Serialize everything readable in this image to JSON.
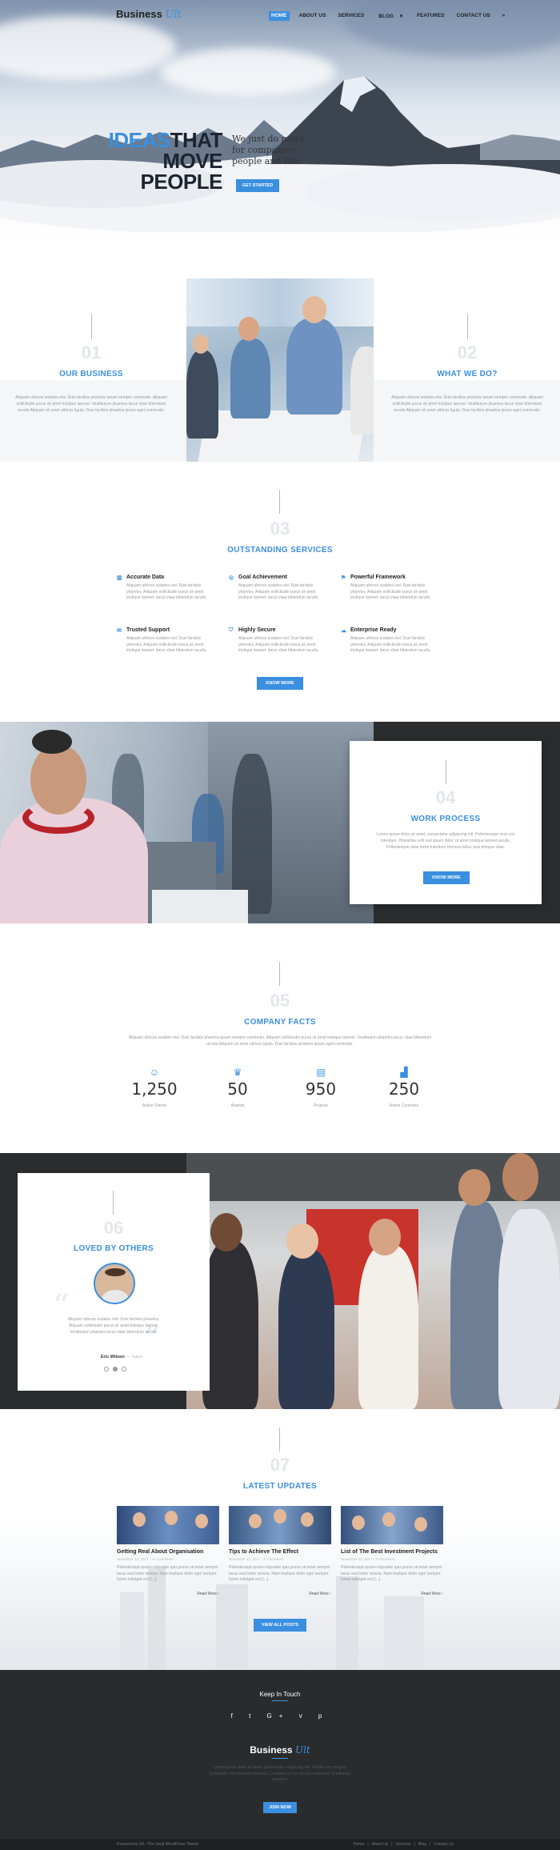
{
  "header": {
    "logo_text": "Business",
    "logo_accent": "Ult",
    "nav": [
      "HOME",
      "ABOUT US",
      "SERVICES",
      "BLOG",
      "FEATURES",
      "CONTACT US"
    ],
    "search_icon": "search-icon"
  },
  "hero": {
    "title_accent": "IDEAS",
    "title_1": "THAT",
    "title_2": "MOVE",
    "title_3": "PEOPLE",
    "subtitle": "We just do more for companies, people and life.",
    "button": "GET STARTED"
  },
  "about": {
    "left": {
      "number": "01",
      "title": "OUR BUSINESS",
      "text": "Aliquam ultrices sodales nisl. Duis facilisis pharetra ipsum semper commodo. Aliquam sollicitudin purus sit amet tristique laoreet. Vestibulum pharetra lacus vitae bibendum iaculis.Aliquam sit amet ultrices ligula. Duis facilisis pharetra ipsum eget commodo."
    },
    "right": {
      "number": "02",
      "title": "WHAT WE DO?",
      "text": "Aliquam ultrices sodales nisl. Duis facilisis pharetra ipsum semper commodo. Aliquam sollicitudin purus sit amet tristique laoreet. Vestibulum pharetra lacus vitae bibendum iaculis.Aliquam sit amet ultrices ligula. Duis facilisis pharetra ipsum eget commodo."
    }
  },
  "services": {
    "number": "03",
    "title": "OUTSTANDING SERVICES",
    "items": [
      {
        "title": "Accurate Data",
        "icon": "chart-icon",
        "text": "Aliquam ultrices sodales nisl. Duis facilisis pharetra. Aliquam sollicitudin purus sit amet tristique laoreet. lacus vitae bibendum iaculis."
      },
      {
        "title": "Goal Achievement",
        "icon": "target-icon",
        "text": "Aliquam ultrices sodales nisl. Duis facilisis pharetra. Aliquam sollicitudin purus sit amet tristique laoreet. lacus vitae bibendum iaculis."
      },
      {
        "title": "Powerful Framework",
        "icon": "flag-icon",
        "text": "Aliquam ultrices sodales nisl. Duis facilisis pharetra. Aliquam sollicitudin purus sit amet tristique laoreet. lacus vitae bibendum iaculis."
      },
      {
        "title": "Trusted Support",
        "icon": "chat-icon",
        "text": "Aliquam ultrices sodales nisl. Duis facilisis pharetra. Aliquam sollicitudin purus sit amet tristique laoreet. lacus vitae bibendum iaculis."
      },
      {
        "title": "Highly Secure",
        "icon": "shield-icon",
        "text": "Aliquam ultrices sodales nisl. Duis facilisis pharetra. Aliquam sollicitudin purus sit amet tristique laoreet. lacus vitae bibendum iaculis."
      },
      {
        "title": "Enterprise Ready",
        "icon": "cloud-icon",
        "text": "Aliquam ultrices sodales nisl. Duis facilisis pharetra. Aliquam sollicitudin purus sit amet tristique laoreet. lacus vitae bibendum iaculis."
      }
    ],
    "button": "KNOW MORE"
  },
  "work": {
    "number": "04",
    "title": "WORK PROCESS",
    "text": "Lorem ipsum dolor sit amet, consectetur adipiscing elit. Pellentesque risus est interdum. Phasellus velit sed ipsum dolor sit amet tristique laoreet iaculis. Pellentesque vitae tortor interdum rhoncus tellus quis tempus vitae.",
    "button": "KNOW MORE"
  },
  "facts": {
    "number": "05",
    "title": "COMPANY FACTS",
    "text": "Aliquam ultrices sodales nisl. Duis facilisis pharetra ipsum semper commodo. Aliquam sollicitudin purus sit amet tristique laoreet. Vestibulum pharetra lacus vitae bibendum iaculis.Aliquam sit amet ultrices ligula. Duis facilisis pharetra ipsum eget commodo.",
    "items": [
      {
        "value": "1,250",
        "label": "Active Clients",
        "icon": "user-icon"
      },
      {
        "value": "50",
        "label": "Awards",
        "icon": "trophy-icon"
      },
      {
        "value": "950",
        "label": "Projects",
        "icon": "briefcase-icon"
      },
      {
        "value": "250",
        "label": "Active Contracts",
        "icon": "chart-icon"
      }
    ]
  },
  "testimonial": {
    "number": "06",
    "title": "LOVED BY OTHERS",
    "text": "Aliquam ultrices sodales nisl. Duis facilisis pharetra. Aliquam sollicitudin purus sit amet tristique laoreet. Vestibulum pharetra lacus vitae bibendum iaculis.",
    "author": "Eric Wilson",
    "role": "Sales"
  },
  "updates": {
    "number": "07",
    "title": "LATEST UPDATES",
    "posts": [
      {
        "title": "Getting Real About Organisation",
        "meta": "November 23, 2017 · no comments",
        "text": "Pellentesque ipsum vulputate quis purus sit amet semper lacus sed tortor viverra. Nam tristique dolor eget semper lorem volutpat orci [...]",
        "more": "Read More ›"
      },
      {
        "title": "Tips to Achieve The Effect",
        "meta": "November 23, 2017 · 0 comments",
        "text": "Pellentesque ipsum vulputate quis purus sit amet semper lacus sed tortor viverra. Nam tristique dolor eget semper lorem volutpat orci [...]",
        "more": "Read More ›"
      },
      {
        "title": "List of The Best Investment Projects",
        "meta": "November 23, 2017 · 0 comments",
        "text": "Pellentesque ipsum vulputate quis purus sit amet semper lacus sed tortor viverra. Nam tristique dolor eget semper lorem volutpat orci [...]",
        "more": "Read More ›"
      }
    ],
    "button": "VIEW ALL POSTS"
  },
  "footer": {
    "keep_title": "Keep In Touch",
    "social": [
      "f",
      "t",
      "G+",
      "v",
      "p"
    ],
    "logo_text": "Business",
    "logo_accent": "Ult",
    "text": "Lorem ipsum dolor sit amet, consectetur adipiscing elit. Nullam non magna. Sollicitudin elit hendrerit pharetra. Curabitur ut nisi vel arcu euismod. Vestibulum pharetra.",
    "button": "JOIN NOW",
    "copyright": "Powered by Ult - The Vault WordPress Theme",
    "links": [
      "Home",
      "About Us",
      "Services",
      "Blog",
      "Contact Us"
    ]
  },
  "colors": {
    "accent": "#3a8fe0",
    "dark": "#2b2c2e"
  }
}
